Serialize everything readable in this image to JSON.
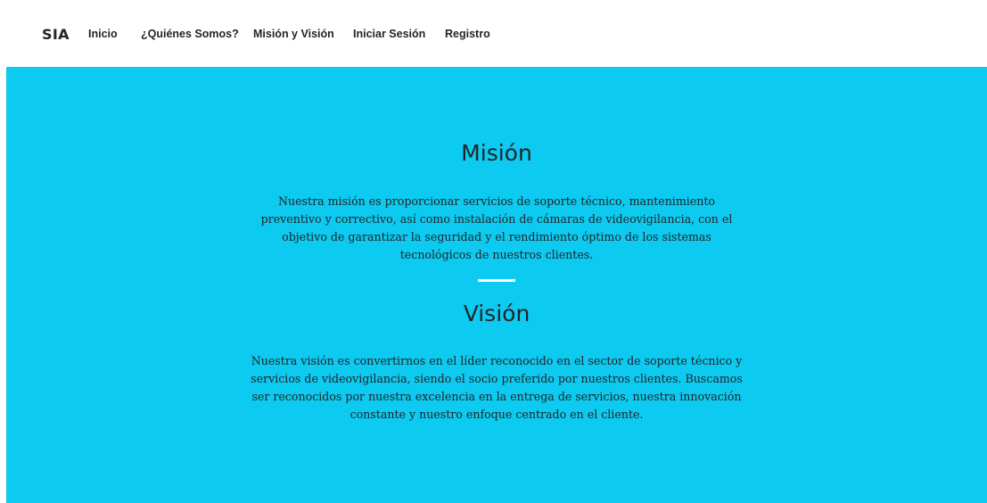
{
  "navbar": {
    "brand": "SIA",
    "links": [
      "Inicio",
      "¿Quiénes Somos?",
      "Misión y Visión",
      "Iniciar Sesión",
      "Registro"
    ]
  },
  "hero": {
    "background_color": "#0dcaf0",
    "divider_color": "#ffffff",
    "mision": {
      "title": "Misión",
      "text": "Nuestra misión es proporcionar servicios de soporte técnico, mantenimiento preventivo y correctivo, así como instalación de cámaras de videovigilancia, con el objetivo de garantizar la seguridad y el rendimiento óptimo de los sistemas tecnológicos de nuestros clientes."
    },
    "vision": {
      "title": "Visión",
      "text": "Nuestra visión es convertirnos en el líder reconocido en el sector de soporte técnico y servicios de videovigilancia, siendo el socio preferido por nuestros clientes. Buscamos ser reconocidos por nuestra excelencia en la entrega de servicios, nuestra innovación constante y nuestro enfoque centrado en el cliente."
    }
  }
}
